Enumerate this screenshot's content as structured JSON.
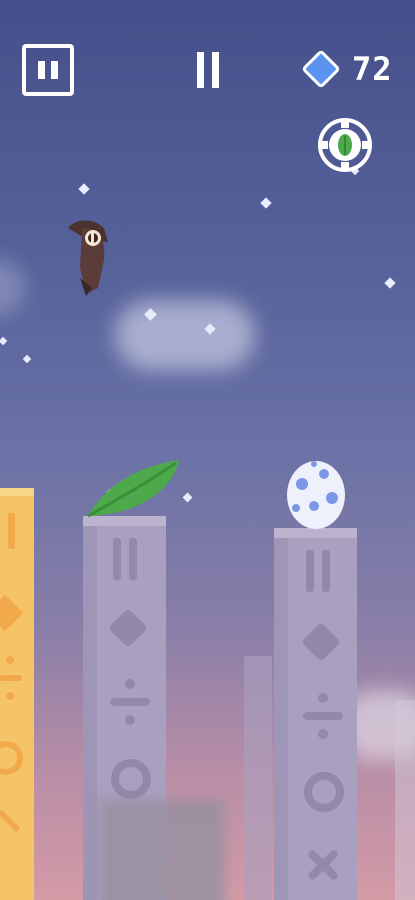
{
  "hud": {
    "pause_button": "pause",
    "pause_indicator": "paused",
    "gem_count": "72",
    "gem_icon": "diamond-gem-icon",
    "leaf_badge_icon": "leaf-badge-icon"
  },
  "colors": {
    "sky_top": "#454f8b",
    "sky_bottom": "#d49aa6",
    "pillar": "#a99fbf",
    "pillar_glyph": "#9288ab",
    "left_pillar": "#f5c467",
    "gem": "#5b93f0",
    "leaf": "#4caa4a",
    "egg_spots": "#7b97e6"
  },
  "scene": {
    "bird": "brown-bird-character",
    "leaf": "green-leaf-pickup",
    "egg": "spotted-egg-pickup"
  }
}
